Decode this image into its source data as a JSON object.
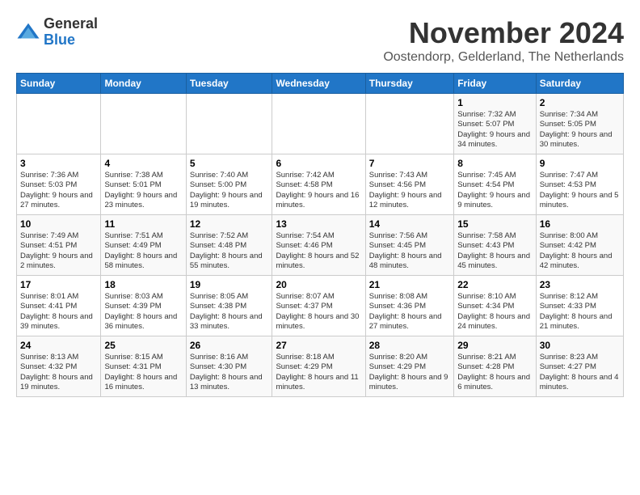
{
  "logo": {
    "general": "General",
    "blue": "Blue"
  },
  "title": "November 2024",
  "location": "Oostendorp, Gelderland, The Netherlands",
  "days_of_week": [
    "Sunday",
    "Monday",
    "Tuesday",
    "Wednesday",
    "Thursday",
    "Friday",
    "Saturday"
  ],
  "weeks": [
    [
      {
        "day": "",
        "info": ""
      },
      {
        "day": "",
        "info": ""
      },
      {
        "day": "",
        "info": ""
      },
      {
        "day": "",
        "info": ""
      },
      {
        "day": "",
        "info": ""
      },
      {
        "day": "1",
        "info": "Sunrise: 7:32 AM\nSunset: 5:07 PM\nDaylight: 9 hours and 34 minutes."
      },
      {
        "day": "2",
        "info": "Sunrise: 7:34 AM\nSunset: 5:05 PM\nDaylight: 9 hours and 30 minutes."
      }
    ],
    [
      {
        "day": "3",
        "info": "Sunrise: 7:36 AM\nSunset: 5:03 PM\nDaylight: 9 hours and 27 minutes."
      },
      {
        "day": "4",
        "info": "Sunrise: 7:38 AM\nSunset: 5:01 PM\nDaylight: 9 hours and 23 minutes."
      },
      {
        "day": "5",
        "info": "Sunrise: 7:40 AM\nSunset: 5:00 PM\nDaylight: 9 hours and 19 minutes."
      },
      {
        "day": "6",
        "info": "Sunrise: 7:42 AM\nSunset: 4:58 PM\nDaylight: 9 hours and 16 minutes."
      },
      {
        "day": "7",
        "info": "Sunrise: 7:43 AM\nSunset: 4:56 PM\nDaylight: 9 hours and 12 minutes."
      },
      {
        "day": "8",
        "info": "Sunrise: 7:45 AM\nSunset: 4:54 PM\nDaylight: 9 hours and 9 minutes."
      },
      {
        "day": "9",
        "info": "Sunrise: 7:47 AM\nSunset: 4:53 PM\nDaylight: 9 hours and 5 minutes."
      }
    ],
    [
      {
        "day": "10",
        "info": "Sunrise: 7:49 AM\nSunset: 4:51 PM\nDaylight: 9 hours and 2 minutes."
      },
      {
        "day": "11",
        "info": "Sunrise: 7:51 AM\nSunset: 4:49 PM\nDaylight: 8 hours and 58 minutes."
      },
      {
        "day": "12",
        "info": "Sunrise: 7:52 AM\nSunset: 4:48 PM\nDaylight: 8 hours and 55 minutes."
      },
      {
        "day": "13",
        "info": "Sunrise: 7:54 AM\nSunset: 4:46 PM\nDaylight: 8 hours and 52 minutes."
      },
      {
        "day": "14",
        "info": "Sunrise: 7:56 AM\nSunset: 4:45 PM\nDaylight: 8 hours and 48 minutes."
      },
      {
        "day": "15",
        "info": "Sunrise: 7:58 AM\nSunset: 4:43 PM\nDaylight: 8 hours and 45 minutes."
      },
      {
        "day": "16",
        "info": "Sunrise: 8:00 AM\nSunset: 4:42 PM\nDaylight: 8 hours and 42 minutes."
      }
    ],
    [
      {
        "day": "17",
        "info": "Sunrise: 8:01 AM\nSunset: 4:41 PM\nDaylight: 8 hours and 39 minutes."
      },
      {
        "day": "18",
        "info": "Sunrise: 8:03 AM\nSunset: 4:39 PM\nDaylight: 8 hours and 36 minutes."
      },
      {
        "day": "19",
        "info": "Sunrise: 8:05 AM\nSunset: 4:38 PM\nDaylight: 8 hours and 33 minutes."
      },
      {
        "day": "20",
        "info": "Sunrise: 8:07 AM\nSunset: 4:37 PM\nDaylight: 8 hours and 30 minutes."
      },
      {
        "day": "21",
        "info": "Sunrise: 8:08 AM\nSunset: 4:36 PM\nDaylight: 8 hours and 27 minutes."
      },
      {
        "day": "22",
        "info": "Sunrise: 8:10 AM\nSunset: 4:34 PM\nDaylight: 8 hours and 24 minutes."
      },
      {
        "day": "23",
        "info": "Sunrise: 8:12 AM\nSunset: 4:33 PM\nDaylight: 8 hours and 21 minutes."
      }
    ],
    [
      {
        "day": "24",
        "info": "Sunrise: 8:13 AM\nSunset: 4:32 PM\nDaylight: 8 hours and 19 minutes."
      },
      {
        "day": "25",
        "info": "Sunrise: 8:15 AM\nSunset: 4:31 PM\nDaylight: 8 hours and 16 minutes."
      },
      {
        "day": "26",
        "info": "Sunrise: 8:16 AM\nSunset: 4:30 PM\nDaylight: 8 hours and 13 minutes."
      },
      {
        "day": "27",
        "info": "Sunrise: 8:18 AM\nSunset: 4:29 PM\nDaylight: 8 hours and 11 minutes."
      },
      {
        "day": "28",
        "info": "Sunrise: 8:20 AM\nSunset: 4:29 PM\nDaylight: 8 hours and 9 minutes."
      },
      {
        "day": "29",
        "info": "Sunrise: 8:21 AM\nSunset: 4:28 PM\nDaylight: 8 hours and 6 minutes."
      },
      {
        "day": "30",
        "info": "Sunrise: 8:23 AM\nSunset: 4:27 PM\nDaylight: 8 hours and 4 minutes."
      }
    ]
  ]
}
